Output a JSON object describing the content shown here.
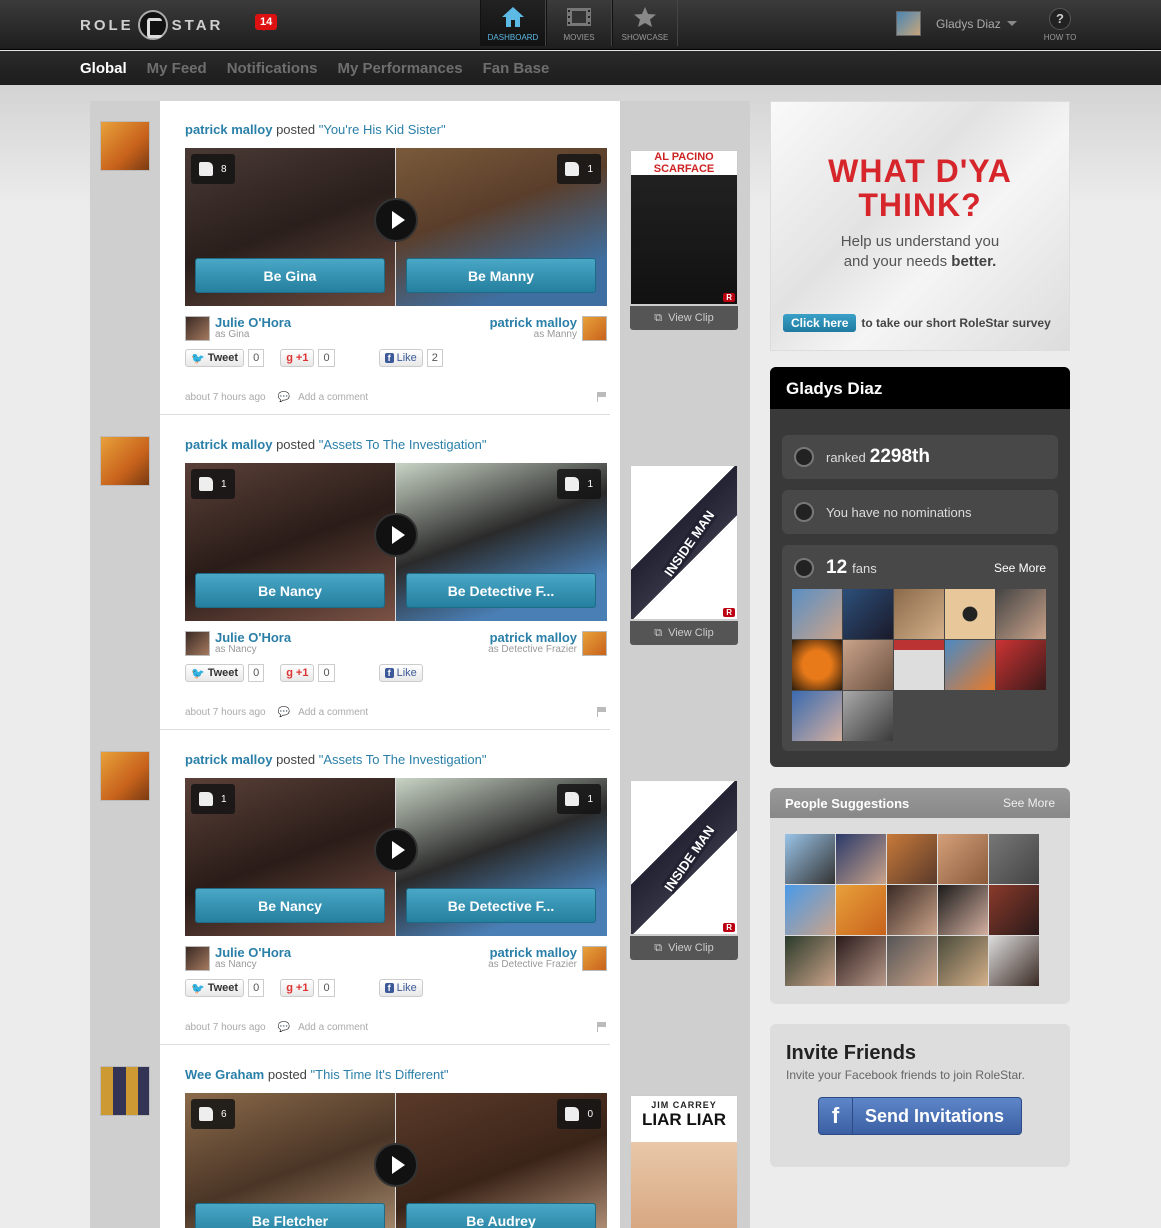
{
  "app": {
    "logo_left": "ROLE",
    "logo_right": "STAR",
    "notifications_count": "14"
  },
  "nav": {
    "tabs": [
      {
        "label": "DASHBOARD",
        "icon": "home-icon",
        "active": true
      },
      {
        "label": "MOVIES",
        "icon": "film-icon",
        "active": false
      },
      {
        "label": "SHOWCASE",
        "icon": "star-icon",
        "active": false
      }
    ]
  },
  "user": {
    "name": "Gladys Diaz"
  },
  "howto": {
    "label": "HOW TO",
    "glyph": "?"
  },
  "subnav": {
    "items": [
      "Global",
      "My Feed",
      "Notifications",
      "My Performances",
      "Fan Base"
    ]
  },
  "posts": [
    {
      "author": "patrick malloy",
      "verb": "posted",
      "title": "\"You're His Kid Sister\"",
      "left_likes": "8",
      "right_likes": "1",
      "left_role": "Be Gina",
      "right_role": "Be Manny",
      "actor_l": "Julie O'Hora",
      "actor_l_role": "as Gina",
      "actor_r": "patrick malloy",
      "actor_r_role": "as Manny",
      "tweet": "Tweet",
      "tweet_count": "0",
      "gplus": "+1",
      "gplus_count": "0",
      "fb": "Like",
      "fb_count": "2",
      "time": "about 7 hours ago",
      "comment": "Add a comment",
      "view_clip": "View Clip",
      "poster": "scarface"
    },
    {
      "author": "patrick malloy",
      "verb": "posted",
      "title": "\"Assets To The Investigation\"",
      "left_likes": "1",
      "right_likes": "1",
      "left_role": "Be Nancy",
      "right_role": "Be Detective F...",
      "actor_l": "Julie O'Hora",
      "actor_l_role": "as Nancy",
      "actor_r": "patrick malloy",
      "actor_r_role": "as Detective Frazier",
      "tweet": "Tweet",
      "tweet_count": "0",
      "gplus": "+1",
      "gplus_count": "0",
      "fb": "Like",
      "fb_count": "",
      "time": "about 7 hours ago",
      "comment": "Add a comment",
      "view_clip": "View Clip",
      "poster": "insideman"
    },
    {
      "author": "patrick malloy",
      "verb": "posted",
      "title": "\"Assets To The Investigation\"",
      "left_likes": "1",
      "right_likes": "1",
      "left_role": "Be Nancy",
      "right_role": "Be Detective F...",
      "actor_l": "Julie O'Hora",
      "actor_l_role": "as Nancy",
      "actor_r": "patrick malloy",
      "actor_r_role": "as Detective Frazier",
      "tweet": "Tweet",
      "tweet_count": "0",
      "gplus": "+1",
      "gplus_count": "0",
      "fb": "Like",
      "fb_count": "",
      "time": "about 7 hours ago",
      "comment": "Add a comment",
      "view_clip": "View Clip",
      "poster": "insideman"
    },
    {
      "author": "Wee Graham",
      "verb": "posted",
      "title": "\"This Time It's Different\"",
      "left_likes": "6",
      "right_likes": "0",
      "left_role": "Be Fletcher",
      "right_role": "Be Audrey",
      "poster": "liarliar"
    }
  ],
  "posters": {
    "scarface": {
      "top": "AL PACINO SCARFACE",
      "badge": "R"
    },
    "insideman": {
      "top": "INSIDE MAN",
      "badge": "R"
    },
    "liarliar": {
      "top": "JIM CARREY",
      "main": "LIAR LIAR"
    }
  },
  "survey": {
    "headline_1": "WHAT D'YA",
    "headline_2": "THINK?",
    "sub_1": "Help us understand you",
    "sub_2a": "and your needs ",
    "sub_2b": "better.",
    "cta_button": "Click here",
    "cta_text": "to take our short RoleStar survey"
  },
  "profile": {
    "name": "Gladys Diaz",
    "rank_prefix": "ranked",
    "rank": "2298th",
    "nominations": "You have no nominations",
    "fans_count": "12",
    "fans_label": "fans",
    "see_more": "See More"
  },
  "people": {
    "title": "People Suggestions",
    "see_more": "See More"
  },
  "invite": {
    "title": "Invite Friends",
    "text": "Invite your Facebook friends to join RoleStar.",
    "button": "Send Invitations"
  },
  "colors": {
    "link": "#2a7fa8",
    "accent": "#3aa0c7",
    "survey_red": "#d6262b"
  }
}
